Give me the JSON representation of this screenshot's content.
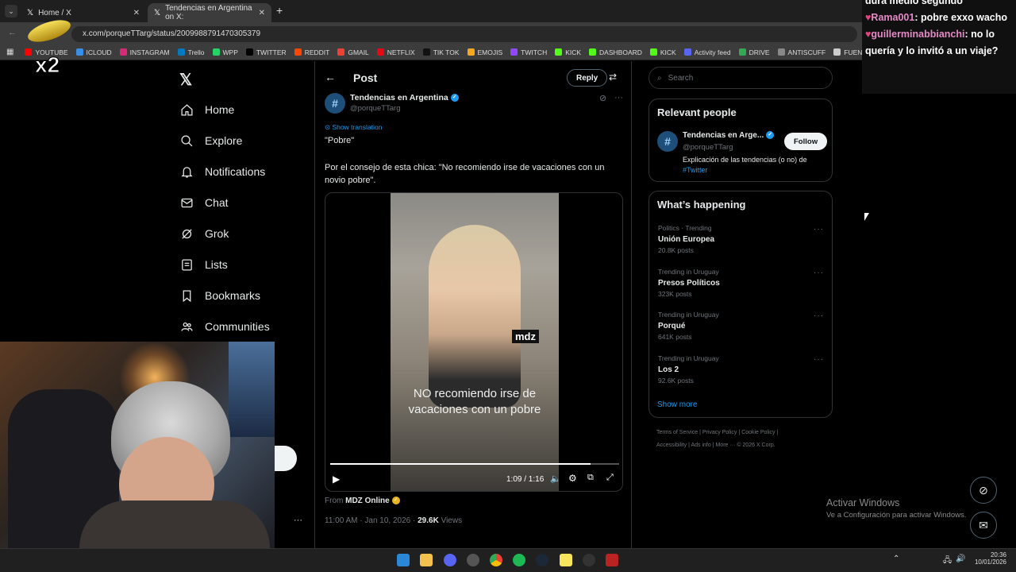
{
  "browser": {
    "tabs": [
      {
        "label": "Home / X",
        "active": false
      },
      {
        "label": "Tendencias en Argentina on X:",
        "active": true
      }
    ],
    "new_tab": "+",
    "url": "x.com/porqueTTarg/status/2009988791470305379",
    "bookmarks": [
      {
        "label": "YOUTUBE",
        "color": "#ff0000"
      },
      {
        "label": "ICLOUD",
        "color": "#3a8ee6"
      },
      {
        "label": "INSTAGRAM",
        "color": "#d62976"
      },
      {
        "label": "Trello",
        "color": "#0079bf"
      },
      {
        "label": "WPP",
        "color": "#25d366"
      },
      {
        "label": "TWITTER",
        "color": "#000000"
      },
      {
        "label": "REDDIT",
        "color": "#ff4500"
      },
      {
        "label": "GMAIL",
        "color": "#ea4335"
      },
      {
        "label": "NETFLIX",
        "color": "#e50914"
      },
      {
        "label": "TIK TOK",
        "color": "#111111"
      },
      {
        "label": "EMOJIS",
        "color": "#f5a623"
      },
      {
        "label": "TWITCH",
        "color": "#9146ff"
      },
      {
        "label": "KICK",
        "color": "#53fc18"
      },
      {
        "label": "DASHBOARD",
        "color": "#53fc18"
      },
      {
        "label": "KICK",
        "color": "#53fc18"
      },
      {
        "label": "Activity feed",
        "color": "#5865f2"
      },
      {
        "label": "DRIVE",
        "color": "#34a853"
      },
      {
        "label": "ANTISCUFF",
        "color": "#888888"
      },
      {
        "label": "FUENTES",
        "color": "#cccccc"
      }
    ]
  },
  "nav": {
    "items": [
      {
        "label": "Home",
        "icon": "home-icon"
      },
      {
        "label": "Explore",
        "icon": "search-icon"
      },
      {
        "label": "Notifications",
        "icon": "bell-icon"
      },
      {
        "label": "Chat",
        "icon": "mail-icon"
      },
      {
        "label": "Grok",
        "icon": "grok-icon"
      },
      {
        "label": "Lists",
        "icon": "list-icon"
      },
      {
        "label": "Bookmarks",
        "icon": "bookmark-icon"
      },
      {
        "label": "Communities",
        "icon": "communities-icon"
      }
    ]
  },
  "post": {
    "header_title": "Post",
    "reply_label": "Reply",
    "author_name": "Tendencias en Argentina",
    "author_handle": "@porqueTTarg",
    "show_translation": "Show translation",
    "text_line1": "\"Pobre\"",
    "text_line2": "Por el consejo de esta chica: \"No recomiendo irse de vacaciones con un novio pobre\".",
    "video": {
      "watermark": "mdz",
      "caption": "NO recomiendo irse de vacaciones con un pobre",
      "time": "1:09 / 1:16",
      "progress": 0.9
    },
    "from_label": "From",
    "from_source": "MDZ Online",
    "timestamp": "11:00 AM · Jan 10, 2026 · ",
    "views_count": "29.6K",
    "views_label": "Views"
  },
  "right": {
    "search_placeholder": "Search",
    "relevant_title": "Relevant people",
    "person": {
      "name": "Tendencias en Arge...",
      "handle": "@porqueTTarg",
      "follow_label": "Follow",
      "bio": "Explicación de las tendencias (o no) de",
      "bio_tag": "#Twitter"
    },
    "happening_title": "What’s happening",
    "trends": [
      {
        "context": "Politics · Trending",
        "title": "Unión Europea",
        "posts": "20.8K posts"
      },
      {
        "context": "Trending in Uruguay",
        "title": "Presos Políticos",
        "posts": "323K posts"
      },
      {
        "context": "Trending in Uruguay",
        "title": "Porqué",
        "posts": "641K posts"
      },
      {
        "context": "Trending in Uruguay",
        "title": "Los 2",
        "posts": "92.6K posts"
      }
    ],
    "show_more": "Show more",
    "footer": {
      "terms": "Terms of Service",
      "privacy": "Privacy Policy",
      "cookie": "Cookie Policy",
      "accessibility": "Accessibility",
      "ads": "Ads info",
      "more": "More ···",
      "copyright": "© 2026 X Corp."
    }
  },
  "chat": {
    "line0": "dura medio segundo",
    "msg1_user": "Rama001",
    "msg1_text": "pobre exxo wacho",
    "msg2_user": "guillerminabbianchi",
    "msg2_text": "no lo quería y lo invitó a un viaje?"
  },
  "overlay_badge": "x2",
  "windows": {
    "activate_title": "Activar Windows",
    "activate_sub": "Ve a Configuración para activar Windows.",
    "clock_time": "20:36",
    "clock_date": "10/01/2026"
  }
}
